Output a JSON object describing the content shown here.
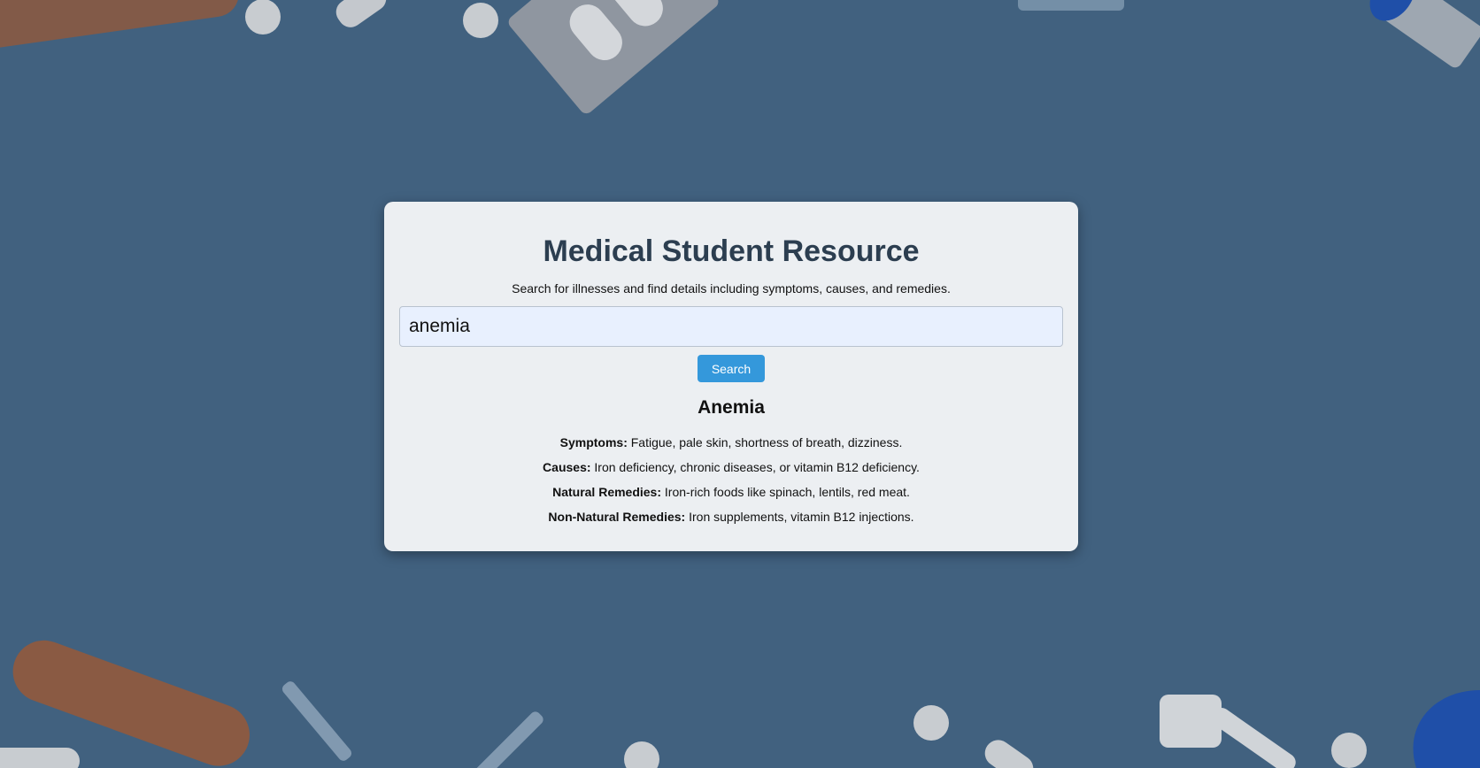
{
  "page": {
    "title": "Medical Student Resource",
    "subtitle": "Search for illnesses and find details including symptoms, causes, and remedies."
  },
  "search": {
    "value": "anemia",
    "button_label": "Search"
  },
  "result": {
    "name": "Anemia",
    "fields": [
      {
        "label": "Symptoms:",
        "text": " Fatigue, pale skin, shortness of breath, dizziness."
      },
      {
        "label": "Causes:",
        "text": " Iron deficiency, chronic diseases, or vitamin B12 deficiency."
      },
      {
        "label": "Natural Remedies:",
        "text": " Iron-rich foods like spinach, lentils, red meat."
      },
      {
        "label": "Non-Natural Remedies:",
        "text": " Iron supplements, vitamin B12 injections."
      }
    ]
  },
  "colors": {
    "background": "#41617f",
    "card": "#eceff2",
    "title": "#2c3e50",
    "button": "#3498db",
    "input": "#e8f0fe"
  }
}
